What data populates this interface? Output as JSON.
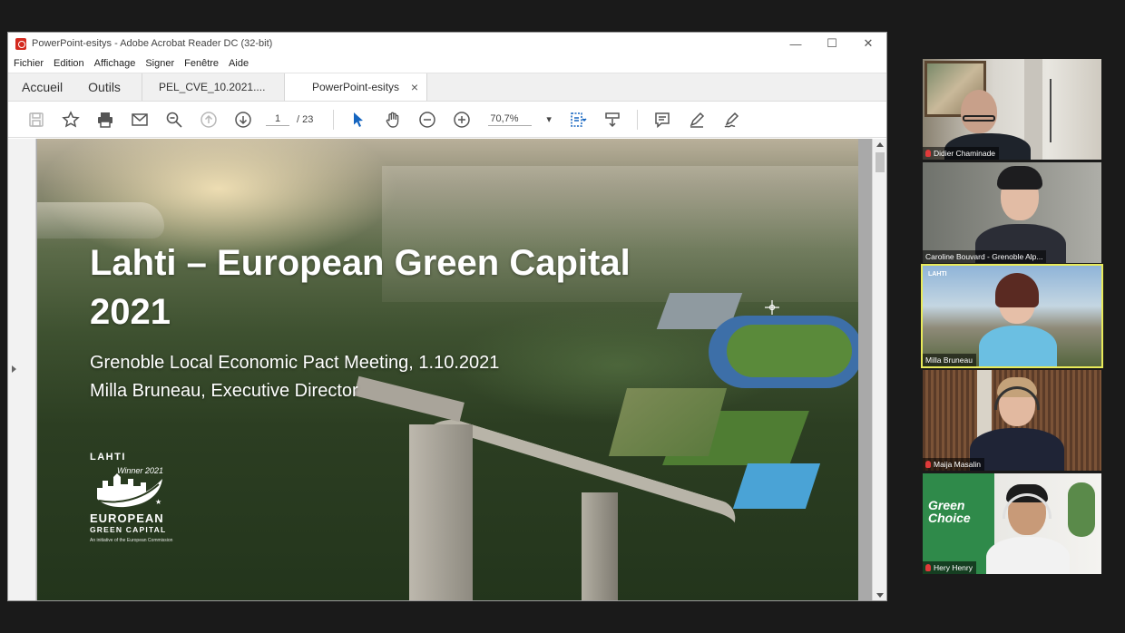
{
  "window": {
    "title": "PowerPoint-esitys - Adobe Acrobat Reader DC (32-bit)",
    "minimize": "—",
    "maximize": "☐",
    "close": "✕"
  },
  "menu": [
    "Fichier",
    "Edition",
    "Affichage",
    "Signer",
    "Fenêtre",
    "Aide"
  ],
  "tabs": {
    "home": "Accueil",
    "tools": "Outils",
    "doc1": "PEL_CVE_10.2021....",
    "doc2": "PowerPoint-esitys",
    "close": "×"
  },
  "toolbar": {
    "page_current": "1",
    "page_total": "/ 23",
    "zoom": "70,7%"
  },
  "slide": {
    "title_line1": "Lahti – European Green Capital",
    "title_line2": "2021",
    "subtitle_line1": "Grenoble Local Economic Pact Meeting, 1.10.2021",
    "subtitle_line2": "Milla Bruneau, Executive Director",
    "logo": {
      "city": "LAHTI",
      "winner": "Winner 2021",
      "line1": "EUROPEAN",
      "line2": "GREEN CAPITAL",
      "footnote": "An initiative of the European Commission"
    }
  },
  "participants": [
    {
      "name": "Didier Chaminade",
      "muted": true
    },
    {
      "name": "Caroline Bouvard - Grenoble Alp...",
      "muted": false
    },
    {
      "name": "Milla Bruneau",
      "muted": false,
      "active": true,
      "bg_text": "LAHTI"
    },
    {
      "name": "Maija Masalin",
      "muted": true
    },
    {
      "name": "Hery Henry",
      "muted": true,
      "bg_text": "Green Choice"
    }
  ],
  "colors": {
    "active_speaker_border": "#e8ea5a",
    "acrobat_red": "#d42a1f",
    "tool_blue": "#1565c0"
  }
}
